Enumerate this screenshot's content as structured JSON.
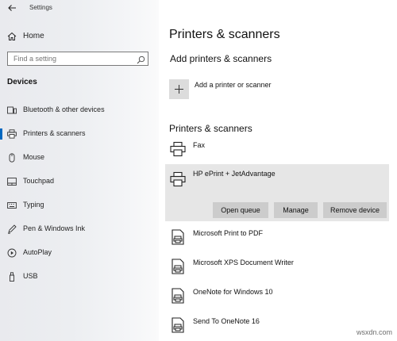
{
  "window": {
    "title": "Settings"
  },
  "sidebar": {
    "home_label": "Home",
    "search_placeholder": "Find a setting",
    "section_label": "Devices",
    "items": [
      {
        "label": "Bluetooth & other devices",
        "icon": "bluetooth-devices-icon"
      },
      {
        "label": "Printers & scanners",
        "icon": "printer-icon",
        "selected": true
      },
      {
        "label": "Mouse",
        "icon": "mouse-icon"
      },
      {
        "label": "Touchpad",
        "icon": "touchpad-icon"
      },
      {
        "label": "Typing",
        "icon": "keyboard-icon"
      },
      {
        "label": "Pen & Windows Ink",
        "icon": "pen-icon"
      },
      {
        "label": "AutoPlay",
        "icon": "autoplay-icon"
      },
      {
        "label": "USB",
        "icon": "usb-icon"
      }
    ]
  },
  "main": {
    "title": "Printers & scanners",
    "add_heading": "Add printers & scanners",
    "add_label": "Add a printer or scanner",
    "list_heading": "Printers & scanners",
    "devices": [
      {
        "name": "Fax",
        "icon": "printer-icon"
      },
      {
        "name": "HP ePrint + JetAdvantage",
        "icon": "printer-icon",
        "expanded": true
      },
      {
        "name": "Microsoft Print to PDF",
        "icon": "document-printer-icon"
      },
      {
        "name": "Microsoft XPS Document Writer",
        "icon": "document-printer-icon"
      },
      {
        "name": "OneNote for Windows 10",
        "icon": "document-printer-icon"
      },
      {
        "name": "Send To OneNote 16",
        "icon": "document-printer-icon"
      }
    ],
    "actions": {
      "open_queue": "Open queue",
      "manage": "Manage",
      "remove_device": "Remove device"
    }
  },
  "watermark": "wsxdn.com",
  "colors": {
    "accent": "#0067c0",
    "button_bg": "#cccccc",
    "expanded_bg": "#e6e6e6"
  }
}
